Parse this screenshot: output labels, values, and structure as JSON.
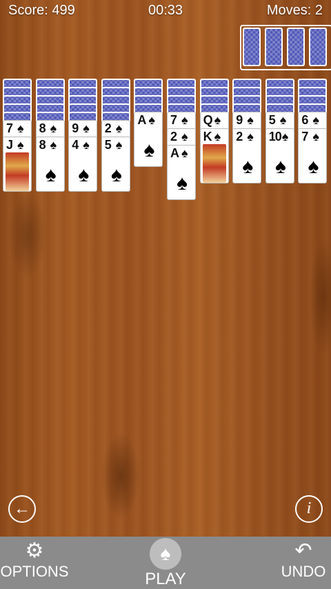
{
  "hud": {
    "score": "Score: 499",
    "time": "00:33",
    "moves": "Moves: 2"
  },
  "stock": {
    "remaining_deals": 4
  },
  "tableau": [
    {
      "hidden": 5,
      "cards": [
        {
          "rank": "7",
          "suit": "♠"
        },
        {
          "rank": "J",
          "suit": "♠",
          "face": true
        }
      ]
    },
    {
      "hidden": 5,
      "cards": [
        {
          "rank": "8",
          "suit": "♠"
        },
        {
          "rank": "8",
          "suit": "♠"
        }
      ]
    },
    {
      "hidden": 5,
      "cards": [
        {
          "rank": "9",
          "suit": "♠"
        },
        {
          "rank": "4",
          "suit": "♠"
        }
      ]
    },
    {
      "hidden": 5,
      "cards": [
        {
          "rank": "2",
          "suit": "♠"
        },
        {
          "rank": "5",
          "suit": "♠"
        }
      ]
    },
    {
      "hidden": 4,
      "cards": [
        {
          "rank": "A",
          "suit": "♠"
        }
      ]
    },
    {
      "hidden": 4,
      "cards": [
        {
          "rank": "7",
          "suit": "♠"
        },
        {
          "rank": "2",
          "suit": "♠"
        },
        {
          "rank": "A",
          "suit": "♠"
        }
      ]
    },
    {
      "hidden": 4,
      "cards": [
        {
          "rank": "Q",
          "suit": "♠"
        },
        {
          "rank": "K",
          "suit": "♠",
          "face": true
        }
      ]
    },
    {
      "hidden": 4,
      "cards": [
        {
          "rank": "9",
          "suit": "♠"
        },
        {
          "rank": "2",
          "suit": "♠"
        }
      ]
    },
    {
      "hidden": 4,
      "cards": [
        {
          "rank": "5",
          "suit": "♠"
        },
        {
          "rank": "10",
          "suit": "♠"
        }
      ]
    },
    {
      "hidden": 4,
      "cards": [
        {
          "rank": "6",
          "suit": "♠"
        },
        {
          "rank": "7",
          "suit": "♠"
        }
      ]
    }
  ],
  "buttons": {
    "back_icon": "←",
    "info_icon": "i"
  },
  "toolbar": {
    "options_label": "OPTIONS",
    "options_icon": "⚙",
    "play_label": "PLAY",
    "play_icon": "♠",
    "undo_label": "UNDO",
    "undo_icon": "↶"
  },
  "colors": {
    "card_back": "#4f57b7",
    "toolbar": "#8b8b8b",
    "table_wood": "#9a5220"
  }
}
